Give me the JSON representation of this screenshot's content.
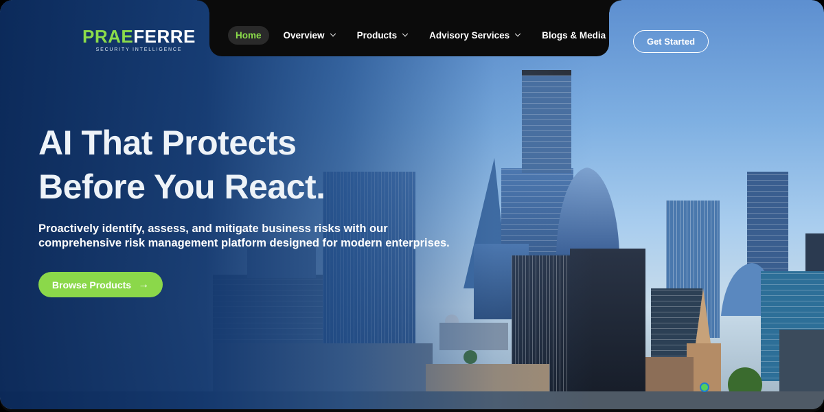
{
  "brand": {
    "name_part1": "PRAE",
    "name_part2": "FERRE",
    "tagline": "SECURITY INTELLIGENCE"
  },
  "nav": {
    "items": [
      {
        "label": "Home",
        "active": true,
        "dropdown": false
      },
      {
        "label": "Overview",
        "active": false,
        "dropdown": true
      },
      {
        "label": "Products",
        "active": false,
        "dropdown": true
      },
      {
        "label": "Advisory Services",
        "active": false,
        "dropdown": true
      },
      {
        "label": "Blogs & Media",
        "active": false,
        "dropdown": false
      }
    ]
  },
  "header": {
    "cta_label": "Get Started"
  },
  "hero": {
    "headline_line1": "AI That Protects",
    "headline_line2": "Before You React.",
    "subtext_line1": "Proactively identify, assess, and mitigate business risks with our",
    "subtext_line2": "comprehensive risk management platform designed for modern enterprises.",
    "button_label": "Browse Products"
  },
  "colors": {
    "accent": "#8bd84a",
    "nav_bg": "#0b0b0b",
    "overlay": "#0a2858"
  },
  "icons": {
    "button_arrow": "arrow-right-icon",
    "dropdown": "chevron-down-icon"
  }
}
